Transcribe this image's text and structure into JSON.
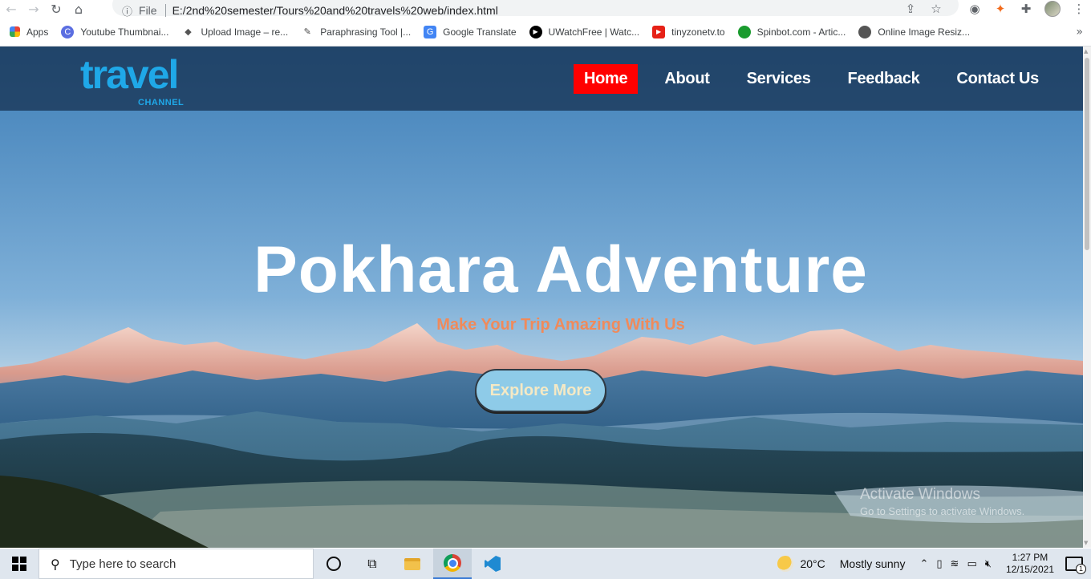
{
  "browser": {
    "scheme": "File",
    "url": "E:/2nd%20semester/Tours%20and%20travels%20web/index.html",
    "bookmarks": [
      {
        "label": "Apps",
        "icon": "apps-grid-icon"
      },
      {
        "label": "Youtube Thumbnai...",
        "icon": "thumbnail-icon"
      },
      {
        "label": "Upload Image – re...",
        "icon": "layers-icon"
      },
      {
        "label": "Paraphrasing Tool |...",
        "icon": "quill-icon"
      },
      {
        "label": "Google Translate",
        "icon": "translate-icon"
      },
      {
        "label": "UWatchFree | Watc...",
        "icon": "play-icon"
      },
      {
        "label": "tinyzonetv.to",
        "icon": "youtube-icon"
      },
      {
        "label": "Spinbot.com - Artic...",
        "icon": "spinbot-icon"
      },
      {
        "label": "Online Image Resiz...",
        "icon": "globe-icon"
      }
    ],
    "bookmarks_more": "»"
  },
  "site": {
    "logo_main": "travel",
    "logo_sub": "CHANNEL",
    "nav": [
      {
        "label": "Home",
        "active": true
      },
      {
        "label": "About",
        "active": false
      },
      {
        "label": "Services",
        "active": false
      },
      {
        "label": "Feedback",
        "active": false
      },
      {
        "label": "Contact Us",
        "active": false
      }
    ],
    "hero_title": "Pokhara Adventure",
    "hero_subtitle": "Make Your Trip Amazing With Us",
    "cta_label": "Explore More",
    "watermark_line1": "Activate Windows",
    "watermark_line2": "Go to Settings to activate Windows."
  },
  "colors": {
    "active_nav": "#ff0000",
    "logo": "#1fa8e8",
    "subtitle": "#f08a5a",
    "cta_bg": "#8ecbe8"
  },
  "taskbar": {
    "search_placeholder": "Type here to search",
    "weather_temp": "20°C",
    "weather_desc": "Mostly sunny",
    "time": "1:27 PM",
    "date": "12/15/2021",
    "notification_count": "1"
  }
}
